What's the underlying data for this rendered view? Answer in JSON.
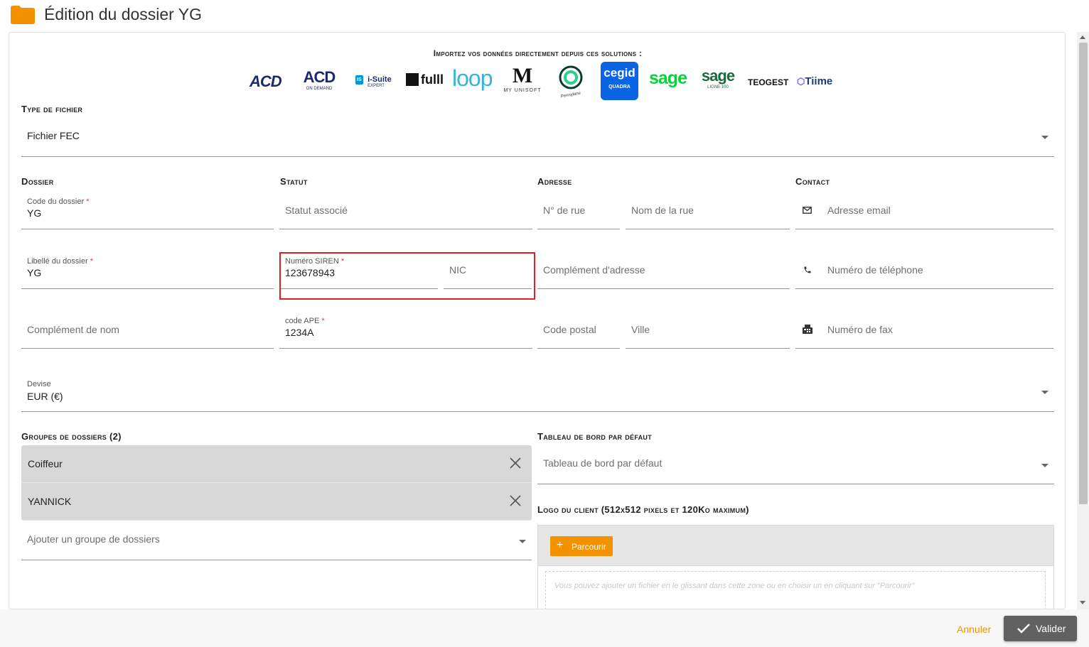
{
  "header": {
    "title": "Édition du dossier YG",
    "folder_color": "#f39200"
  },
  "import": {
    "title": "Importez vos données directement depuis ces solutions :",
    "logos": [
      {
        "name": "ACD",
        "text": "ACD"
      },
      {
        "name": "ACD On Demand",
        "text": "ACD",
        "sub": "ON DEMAND"
      },
      {
        "name": "iSuite Expert",
        "text": "i-Suite",
        "sub": "EXPERT",
        "badge": "IS"
      },
      {
        "name": "fulll",
        "text": "fulll"
      },
      {
        "name": "loop",
        "text": "loop"
      },
      {
        "name": "My Unisoft",
        "text": "M",
        "sub": "MY UNISOFT"
      },
      {
        "name": "Pennylane",
        "sub": "Pennylane"
      },
      {
        "name": "Cegid Quadra",
        "text": "cegid",
        "sub": "QUADRA"
      },
      {
        "name": "sage",
        "text": "sage"
      },
      {
        "name": "sage ligne 100",
        "text": "sage",
        "sub": "LIGNE 100"
      },
      {
        "name": "Teogest",
        "text": "TEOGEST"
      },
      {
        "name": "Tiime",
        "text": "Tiime"
      }
    ]
  },
  "file_type": {
    "section": "Type de fichier",
    "value": "Fichier FEC"
  },
  "dossier": {
    "section": "Dossier",
    "code_label": "Code du dossier",
    "code_value": "YG",
    "libelle_label": "Libellé du dossier",
    "libelle_value": "YG",
    "complement_placeholder": "Complément de nom",
    "required_mark": "*"
  },
  "statut": {
    "section": "Statut",
    "statut_placeholder": "Statut associé",
    "siren_label": "Numéro SIREN",
    "siren_value": "123678943",
    "nic_placeholder": "NIC",
    "ape_label": "code APE",
    "ape_value": "1234A"
  },
  "adresse": {
    "section": "Adresse",
    "num_rue": "N° de rue",
    "nom_rue": "Nom de la rue",
    "complement": "Complément d'adresse",
    "code_postal": "Code postal",
    "ville": "Ville"
  },
  "contact": {
    "section": "Contact",
    "email": "Adresse email",
    "telephone": "Numéro de téléphone",
    "fax": "Numéro de fax"
  },
  "devise": {
    "label": "Devise",
    "value": "EUR (€)"
  },
  "groupes": {
    "section": "Groupes de dossiers (2)",
    "items": [
      "Coiffeur",
      "YANNICK"
    ],
    "add_placeholder": "Ajouter un groupe de dossiers"
  },
  "tableau": {
    "section": "Tableau de bord par défaut",
    "placeholder": "Tableau de bord par défaut"
  },
  "logo_client": {
    "section": "Logo du client (512x512 pixels et 120Ko maximum)",
    "browse_label": "Parcourir",
    "drop_text": "Vous pouvez ajouter un fichier en le glissant dans cette zone ou en choisir un en cliquant sur \"Parcourir\""
  },
  "footer": {
    "cancel_label": "Annuler",
    "validate_label": "Valider"
  }
}
